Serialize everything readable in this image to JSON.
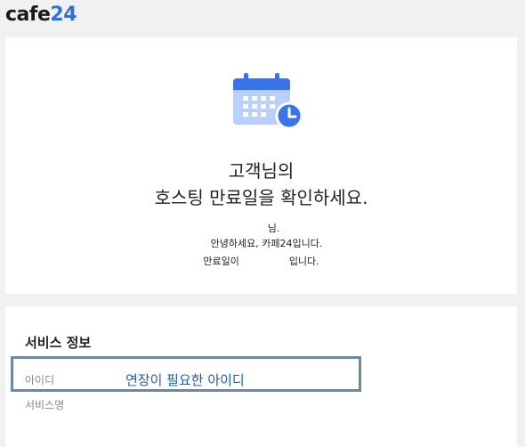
{
  "header": {
    "logo_main": "cafe",
    "logo_num": "24"
  },
  "hero": {
    "icon": "calendar-clock-icon",
    "headline_line1": "고객님의",
    "headline_line2": "호스팅 만료일을 확인하세요.",
    "greeting_name_suffix": "님.",
    "greeting_line": "안녕하세요, 카페24입니다.",
    "expiry_prefix": "만료일이",
    "expiry_suffix": "입니다."
  },
  "service_info": {
    "title": "서비스 정보",
    "field_id_label": "아이디",
    "field_service_label": "서비스명"
  },
  "annotation": {
    "text": "연장이 필요한 아이디",
    "border_color": "#6b88a6"
  },
  "colors": {
    "accent": "#2f6fe0"
  }
}
